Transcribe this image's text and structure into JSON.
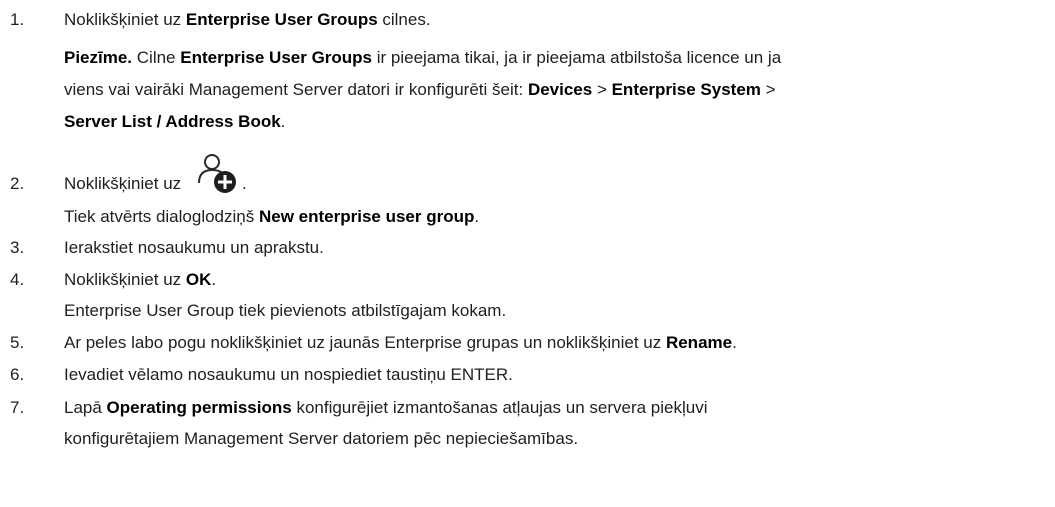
{
  "steps": [
    {
      "number": "1.",
      "text_pre": "Noklikšķiniet uz ",
      "text_bold": "Enterprise User Groups",
      "text_post": " cilnes.",
      "note": {
        "label": "Piezīme.",
        "l1_a": " Cilne ",
        "l1_b": "Enterprise User Groups",
        "l1_c": " ir pieejama tikai, ja ir pieejama atbilstoša licence un ja",
        "l2_a": "viens vai vairāki Management Server datori ir konfigurēti šeit: ",
        "l2_b": "Devices",
        "l2_c": " > ",
        "l2_d": "Enterprise System",
        "l2_e": " >",
        "l3_a": "Server List / Address Book",
        "l3_b": "."
      }
    },
    {
      "number": "2.",
      "text_pre": "Noklikšķiniet uz",
      "icon": "add-user-group-icon",
      "text_post": ".",
      "result_pre": "Tiek atvērts dialoglodziņš ",
      "result_bold": "New enterprise user group",
      "result_post": "."
    },
    {
      "number": "3.",
      "text": "Ierakstiet nosaukumu un aprakstu."
    },
    {
      "number": "4.",
      "text_pre": "Noklikšķiniet uz ",
      "text_bold": "OK",
      "text_post": ".",
      "result": "Enterprise User Group tiek pievienots atbilstīgajam kokam."
    },
    {
      "number": "5.",
      "text_pre": "Ar peles labo pogu noklikšķiniet uz jaunās Enterprise grupas un noklikšķiniet uz ",
      "text_bold": "Rename",
      "text_post": "."
    },
    {
      "number": "6.",
      "text": "Ievadiet vēlamo nosaukumu un nospiediet taustiņu ENTER."
    },
    {
      "number": "7.",
      "text_pre": "Lapā ",
      "text_bold": "Operating permissions",
      "text_post": " konfigurējiet izmantošanas atļaujas un servera piekļuvi",
      "line2": "konfigurētajiem Management Server datoriem pēc nepieciešamības."
    }
  ]
}
